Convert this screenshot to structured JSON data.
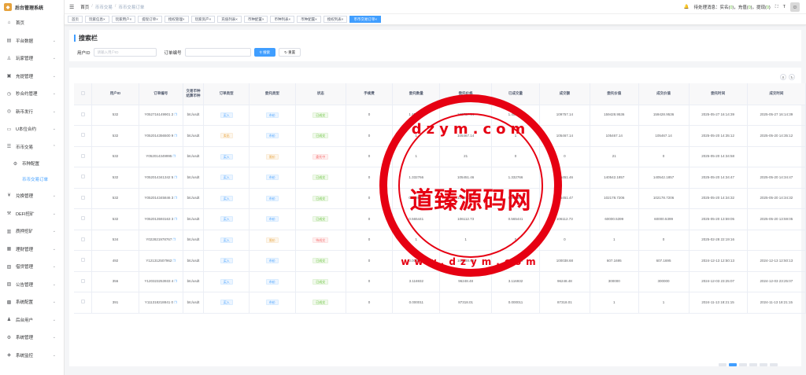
{
  "app": {
    "title": "后台管理系统"
  },
  "sidebar": {
    "items": [
      {
        "label": "首页",
        "icon": "home-icon",
        "glyph": "⌂"
      },
      {
        "label": "平台数据",
        "icon": "chart-icon",
        "glyph": "▤",
        "arrow": "⌄"
      },
      {
        "label": "玩家管理",
        "icon": "user-icon",
        "glyph": "♙",
        "arrow": "⌄"
      },
      {
        "label": "充提管理",
        "icon": "wallet-icon",
        "glyph": "▣",
        "arrow": "⌄"
      },
      {
        "label": "秒合约管理",
        "icon": "clock-icon",
        "glyph": "◷",
        "arrow": "⌄"
      },
      {
        "label": "新币发行",
        "icon": "coin-icon",
        "glyph": "◎",
        "arrow": "⌄"
      },
      {
        "label": "U本位合约",
        "icon": "contract-icon",
        "glyph": "▭",
        "arrow": "⌄"
      },
      {
        "label": "币币交易",
        "icon": "trade-icon",
        "glyph": "☰",
        "arrow": "⌃"
      }
    ],
    "sub": [
      {
        "label": "币种配置"
      },
      {
        "label": "币币交易订单"
      }
    ],
    "items2": [
      {
        "label": "兑换管理",
        "icon": "exchange-icon",
        "glyph": "¥",
        "arrow": "⌄"
      },
      {
        "label": "DEFI挖矿",
        "icon": "mining-icon",
        "glyph": "⚒",
        "arrow": "⌄"
      },
      {
        "label": "质押挖矿",
        "icon": "stake-icon",
        "glyph": "▥",
        "arrow": "⌄"
      },
      {
        "label": "理财管理",
        "icon": "finance-icon",
        "glyph": "▦",
        "arrow": "⌄"
      },
      {
        "label": "借贷管理",
        "icon": "loan-icon",
        "glyph": "▧",
        "arrow": "⌄"
      },
      {
        "label": "公告管理",
        "icon": "notice-icon",
        "glyph": "▨",
        "arrow": "⌄"
      },
      {
        "label": "系统配置",
        "icon": "config-icon",
        "glyph": "▩",
        "arrow": "⌄"
      },
      {
        "label": "后台用户",
        "icon": "admin-icon",
        "glyph": "♟",
        "arrow": "⌄"
      },
      {
        "label": "系统管理",
        "icon": "gear-icon",
        "glyph": "⚙",
        "arrow": "⌄"
      },
      {
        "label": "系统监控",
        "icon": "monitor-icon",
        "glyph": "◈",
        "arrow": "⌄"
      }
    ]
  },
  "breadcrumb": {
    "home": "首页",
    "sep": "/",
    "l1": "币币交易",
    "l2": "币币交易订单"
  },
  "topbar": {
    "pending": "待处理消息：",
    "recharge": "充值(",
    "recharge_n": "0",
    "recharge_end": ")，",
    "withdraw": "提现(",
    "withdraw_n": "0",
    "withdraw_end": ")",
    "realname": "实名(",
    "realname_n": "0",
    "realname_end": ")，"
  },
  "tabs": [
    "首页",
    "玩家信息",
    "玩家用户",
    "提现订单",
    "授权管理",
    "玩家资产",
    "充值列表",
    "币种配置",
    "币种列表",
    "币种配置",
    "授权列表",
    "币币交易订单"
  ],
  "search": {
    "title": "搜索栏",
    "uid_label": "用户ID",
    "uid_placeholder": "请输入用户ID",
    "order_label": "订单编号",
    "order_placeholder": "",
    "search_btn": "搜索",
    "reset_btn": "重置"
  },
  "table": {
    "headers": [
      "用户ID",
      "订单编号",
      "交易币种\n结算币种",
      "订单类型",
      "委托类型",
      "状态",
      "手续费",
      "委托数量",
      "委托价格",
      "已成交量",
      "成交额",
      "委托价值",
      "成交价值",
      "委托时间",
      "成交时间"
    ],
    "rows": [
      [
        "532",
        "Y052716149901 2",
        "btc/usdt",
        "买入",
        "blue",
        "市价",
        "blue",
        "已成交",
        "green",
        "0",
        "1.452561",
        "109757.14",
        "1.452561",
        "109757.14",
        "159428.9536",
        "159428.9536",
        "2025-05-27 16:14:39",
        "2025-05-27 16:14:39"
      ],
      [
        "532",
        "Y052014356500 9",
        "btc/usdt",
        "卖出",
        "orange",
        "市价",
        "blue",
        "已成交",
        "green",
        "0",
        "1",
        "105467.14",
        "1",
        "105467.14",
        "105467.14",
        "105467.14",
        "2025-05-20 14:35:12",
        "2025-05-20 14:35:12"
      ],
      [
        "532",
        "Y052014349995",
        "btc/usdt",
        "买入",
        "blue",
        "限价",
        "orange",
        "委托中",
        "red",
        "0",
        "1",
        "21",
        "0",
        "0",
        "21",
        "0",
        "2025-05-20 14:34:58",
        ""
      ],
      [
        "532",
        "Y052014341342 5",
        "btc/usdt",
        "买入",
        "blue",
        "市价",
        "blue",
        "已成交",
        "green",
        "0",
        "1.332766",
        "105451.46",
        "1.332766",
        "105451.46",
        "140542.1857",
        "140542.1857",
        "2025-05-20 14:34:47",
        "2025-05-20 14:34:47"
      ],
      [
        "532",
        "Y052014345846 3",
        "btc/usdt",
        "买入",
        "blue",
        "市价",
        "blue",
        "已成交",
        "green",
        "0",
        "0.968964",
        "105451.47",
        "0.968964",
        "105451.47",
        "102178.7206",
        "102178.7206",
        "2025-05-20 14:34:32",
        "2025-05-20 14:34:32"
      ],
      [
        "532",
        "Y052013593163 3",
        "btc/usdt",
        "买入",
        "blue",
        "市价",
        "blue",
        "已成交",
        "green",
        "0",
        "0.565441",
        "106112.73",
        "0.565441",
        "106112.73",
        "60000.5399",
        "60000.5399",
        "2025-05-20 13:59:05",
        "2025-05-20 13:59:05"
      ],
      [
        "534",
        "Y022821978767",
        "btc/usdt",
        "买入",
        "blue",
        "限价",
        "orange",
        "待成交",
        "red",
        "0",
        "1",
        "1",
        "0",
        "0",
        "1",
        "0",
        "2025-02-28 22:19:16",
        ""
      ],
      [
        "492",
        "Y121312507962",
        "btc/usdt",
        "买入",
        "blue",
        "市价",
        "blue",
        "已成交",
        "green",
        "0",
        "0.006069",
        "100038.68",
        "0.006069",
        "100038.68",
        "607.1695",
        "607.1695",
        "2024-12-13 12:50:13",
        "2024-12-13 12:50:13"
      ],
      [
        "356",
        "Y120323253933 4",
        "btc/usdt",
        "买入",
        "blue",
        "市价",
        "blue",
        "已成交",
        "green",
        "0",
        "3.116932",
        "96248.48",
        "3.116932",
        "96248.48",
        "300000",
        "300000",
        "2024-12-03 23:25:07",
        "2024-12-03 23:25:07"
      ],
      [
        "391",
        "Y111318218841 0",
        "btc/usdt",
        "买入",
        "blue",
        "市价",
        "blue",
        "已成交",
        "green",
        "0",
        "0.000011",
        "87318.01",
        "0.000011",
        "87318.01",
        "1",
        "1",
        "2024-11-13 18:21:15",
        "2024-11-13 18:21:15"
      ]
    ]
  },
  "watermark": {
    "top": "dzym.com",
    "middle": "道臻源码网",
    "bottom": "www.dzym.com"
  }
}
